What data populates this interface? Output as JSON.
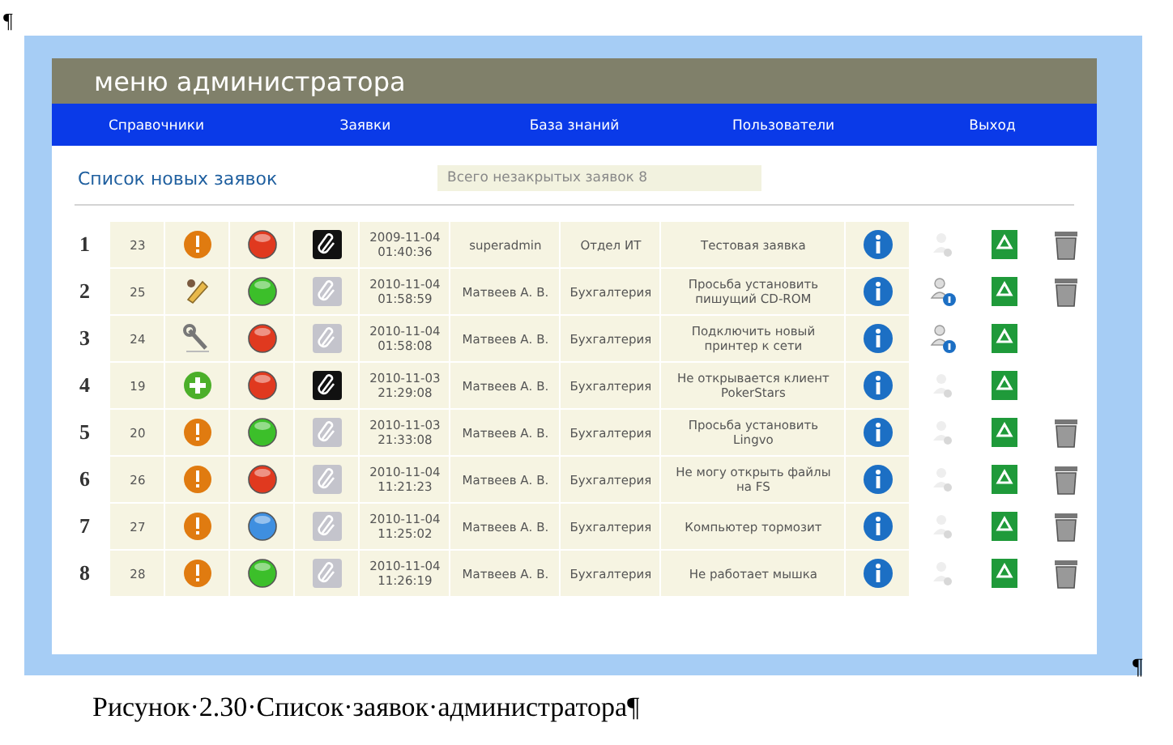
{
  "document": {
    "top_mark": "¶",
    "figure_mark": "¶",
    "caption": "Рисунок·2.30·Список·заявок·администратора¶"
  },
  "app": {
    "title": "меню администратора",
    "nav": [
      {
        "label": "Справочники"
      },
      {
        "label": "Заявки"
      },
      {
        "label": "База знаний"
      },
      {
        "label": "Пользователи"
      },
      {
        "label": "Выход"
      }
    ],
    "heading": "Список новых заявок",
    "counter": "Всего незакрытых заявок  8",
    "rows": [
      {
        "number": "1",
        "id": "23",
        "kind": "alert",
        "color": "#e0391f",
        "attachment": true,
        "date": "2009-11-04",
        "time": "01:40:36",
        "user": "superadmin",
        "department": "Отдел ИТ",
        "subject": "Тестовая заявка",
        "assigned": false,
        "deletable": true
      },
      {
        "number": "2",
        "id": "25",
        "kind": "edit",
        "color": "#3cbf2a",
        "attachment": false,
        "date": "2010-11-04",
        "time": "01:58:59",
        "user": "Матвеев А. В.",
        "department": "Бухгалтерия",
        "subject": "Просьба установить пишущий CD-ROM",
        "assigned": true,
        "deletable": true
      },
      {
        "number": "3",
        "id": "24",
        "kind": "tool",
        "color": "#e0391f",
        "attachment": false,
        "date": "2010-11-04",
        "time": "01:58:08",
        "user": "Матвеев А. В.",
        "department": "Бухгалтерия",
        "subject": "Подключить новый принтер к сети",
        "assigned": true,
        "deletable": false
      },
      {
        "number": "4",
        "id": "19",
        "kind": "add",
        "color": "#e0391f",
        "attachment": true,
        "date": "2010-11-03",
        "time": "21:29:08",
        "user": "Матвеев А. В.",
        "department": "Бухгалтерия",
        "subject": "Не открывается клиент PokerStars",
        "assigned": false,
        "deletable": false
      },
      {
        "number": "5",
        "id": "20",
        "kind": "alert",
        "color": "#3cbf2a",
        "attachment": false,
        "date": "2010-11-03",
        "time": "21:33:08",
        "user": "Матвеев А. В.",
        "department": "Бухгалтерия",
        "subject": "Просьба установить Lingvo",
        "assigned": false,
        "deletable": true
      },
      {
        "number": "6",
        "id": "26",
        "kind": "alert",
        "color": "#e0391f",
        "attachment": false,
        "date": "2010-11-04",
        "time": "11:21:23",
        "user": "Матвеев А. В.",
        "department": "Бухгалтерия",
        "subject": "Не могу открыть файлы на FS",
        "assigned": false,
        "deletable": true
      },
      {
        "number": "7",
        "id": "27",
        "kind": "alert",
        "color": "#3f8fe0",
        "attachment": false,
        "date": "2010-11-04",
        "time": "11:25:02",
        "user": "Матвеев А. В.",
        "department": "Бухгалтерия",
        "subject": "Компьютер тормозит",
        "assigned": false,
        "deletable": true
      },
      {
        "number": "8",
        "id": "28",
        "kind": "alert",
        "color": "#3cbf2a",
        "attachment": false,
        "date": "2010-11-04",
        "time": "11:26:19",
        "user": "Матвеев А. В.",
        "department": "Бухгалтерия",
        "subject": "Не работает мышка",
        "assigned": false,
        "deletable": true
      }
    ]
  }
}
